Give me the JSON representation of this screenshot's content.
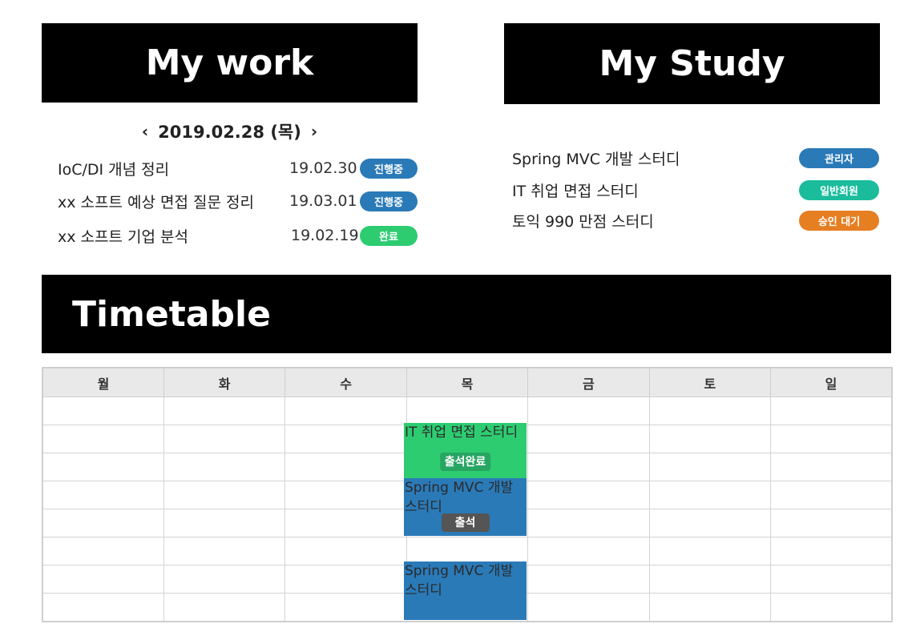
{
  "work": {
    "header": "My work",
    "date_label": "2019.02.28 (목)",
    "prev_icon": "chevron-left-icon",
    "next_icon": "chevron-right-icon",
    "items": [
      {
        "title": "IoC/DI 개념 정리",
        "date": "19.02.30",
        "status": "진행중",
        "status_color": "#2a7ab8"
      },
      {
        "title": "xx 소프트 예상 면접 질문 정리",
        "date": "19.03.01",
        "status": "진행중",
        "status_color": "#2a7ab8"
      },
      {
        "title": "xx 소프트 기업 분석",
        "date": "19.02.19",
        "status": "완료",
        "status_color": "#2ecc71"
      }
    ]
  },
  "study": {
    "header": "My Study",
    "items": [
      {
        "title": "Spring MVC 개발 스터디",
        "role": "관리자",
        "role_color": "#2a7ab8"
      },
      {
        "title": "IT 취업 면접 스터디",
        "role": "일반회원",
        "role_color": "#1abc9c"
      },
      {
        "title": "토익 990 만점 스터디",
        "role": "승인 대기",
        "role_color": "#e67e22"
      }
    ]
  },
  "timetable": {
    "header": "Timetable",
    "days": [
      "월",
      "화",
      "수",
      "목",
      "금",
      "토",
      "일"
    ],
    "events": [
      {
        "title": "IT 취업 면접 스터디",
        "day": "목",
        "badge": "출석완료",
        "color": "#2ecc71",
        "badge_color": "#27a563"
      },
      {
        "title": "Spring MVC 개발 스터디",
        "day": "목",
        "badge": "출석",
        "color": "#2a7ab8",
        "badge_color": "#555555"
      },
      {
        "title": "Spring MVC 개발 스터디",
        "day": "목",
        "badge": "",
        "color": "#2a7ab8",
        "badge_color": ""
      }
    ]
  }
}
